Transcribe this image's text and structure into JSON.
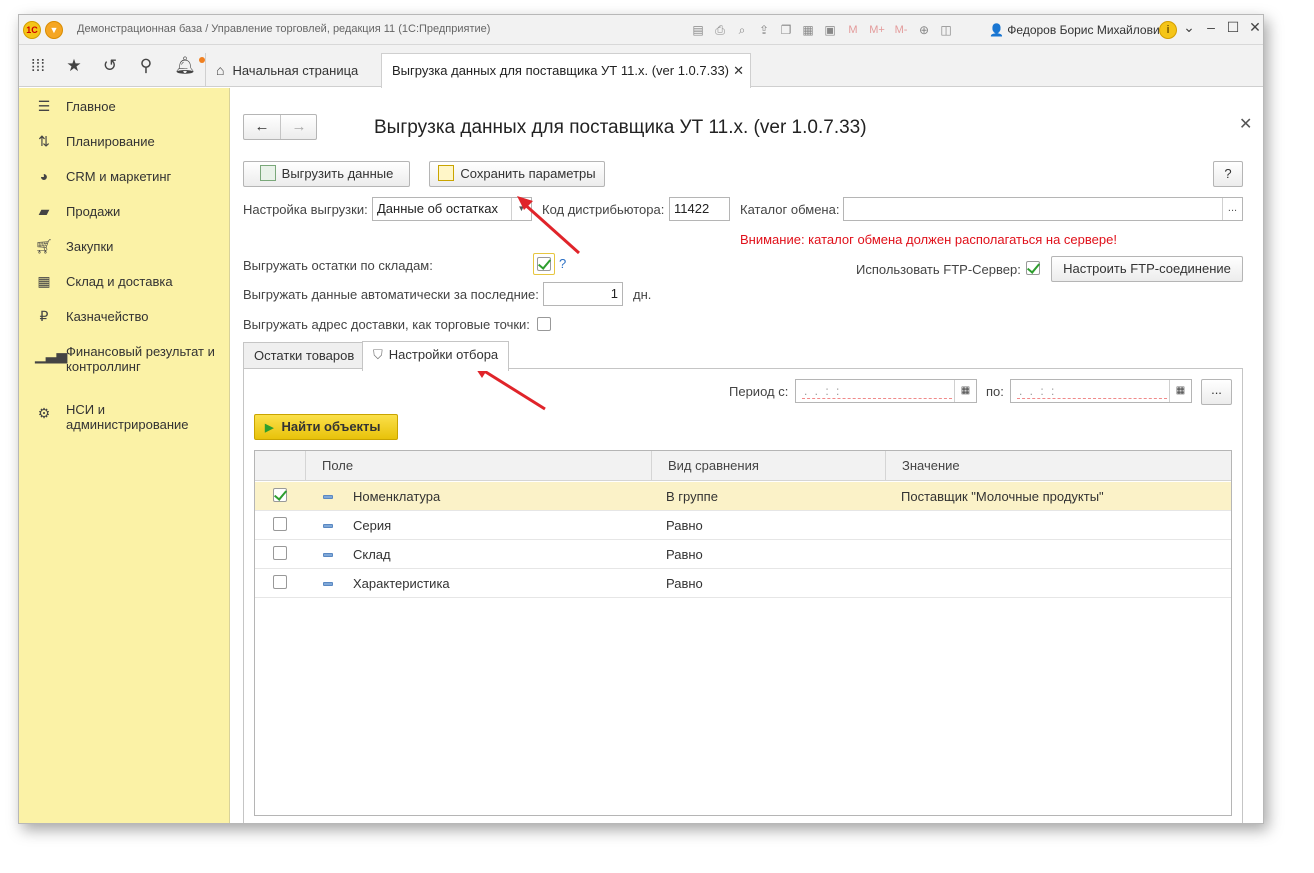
{
  "window": {
    "title": "Демонстрационная база / Управление торговлей, редакция 11  (1С:Предприятие)",
    "user": "Федоров Борис Михайлович",
    "memory_buttons": [
      "M",
      "M+",
      "M-"
    ]
  },
  "tabs": {
    "home": "Начальная страница",
    "doc": "Выгрузка данных для поставщика УТ 11.x. (ver 1.0.7.33)"
  },
  "sidebar": {
    "items": [
      {
        "label": "Главное",
        "icon": "menu-lines-icon"
      },
      {
        "label": "Планирование",
        "icon": "planning-icon"
      },
      {
        "label": "CRM и маркетинг",
        "icon": "pie-chart-icon"
      },
      {
        "label": "Продажи",
        "icon": "bag-icon"
      },
      {
        "label": "Закупки",
        "icon": "cart-icon"
      },
      {
        "label": "Склад и доставка",
        "icon": "warehouse-icon"
      },
      {
        "label": "Казначейство",
        "icon": "ruble-icon"
      },
      {
        "label": "Финансовый результат и контроллинг",
        "icon": "bar-chart-icon"
      },
      {
        "label": "НСИ и администрирование",
        "icon": "gear-icon"
      }
    ]
  },
  "form": {
    "title": "Выгрузка данных для поставщика УТ 11.x. (ver 1.0.7.33)",
    "upload_button": "Выгрузить данные",
    "save_params_button": "Сохранить параметры",
    "help_button": "?",
    "setting_label": "Настройка выгрузки:",
    "setting_value": "Данные об остатках",
    "distributor_label": "Код дистрибьютора:",
    "distributor_value": "11422",
    "catalog_label": "Каталог обмена:",
    "catalog_value": "",
    "catalog_select": "...",
    "warning": "Внимание: каталог обмена должен располагаться на сервере!",
    "stock_by_wh_label": "Выгружать остатки по складам:",
    "stock_by_wh_checked": true,
    "help_mark": "?",
    "ftp_label": "Использовать FTP-Сервер:",
    "ftp_checked": true,
    "ftp_button": "Настроить FTP-соединение",
    "auto_label": "Выгружать данные автоматически за последние:",
    "auto_value": "1",
    "auto_unit": "дн.",
    "address_label": "Выгружать адрес доставки, как торговые точки:",
    "address_checked": false
  },
  "content_tabs": {
    "stock": "Остатки товаров",
    "filter": "Настройки отбора"
  },
  "filter": {
    "period_from_label": "Период с:",
    "period_to_label": "по:",
    "date_mask": ". .   : :",
    "more_button": "...",
    "find_button": "Найти объекты"
  },
  "grid": {
    "columns": [
      "Поле",
      "Вид сравнения",
      "Значение"
    ],
    "rows": [
      {
        "checked": true,
        "field": "Номенклатура",
        "comparison": "В группе",
        "value": "Поставщик \"Молочные продукты\""
      },
      {
        "checked": false,
        "field": "Серия",
        "comparison": "Равно",
        "value": ""
      },
      {
        "checked": false,
        "field": "Склад",
        "comparison": "Равно",
        "value": ""
      },
      {
        "checked": false,
        "field": "Характеристика",
        "comparison": "Равно",
        "value": ""
      }
    ]
  },
  "colors": {
    "sidebar_bg": "#fbf2a6",
    "warning": "#e0101a",
    "accent_yellow": "#f5c518",
    "selected_row": "#fbf2c8",
    "annotation_arrow": "#e0242a"
  }
}
